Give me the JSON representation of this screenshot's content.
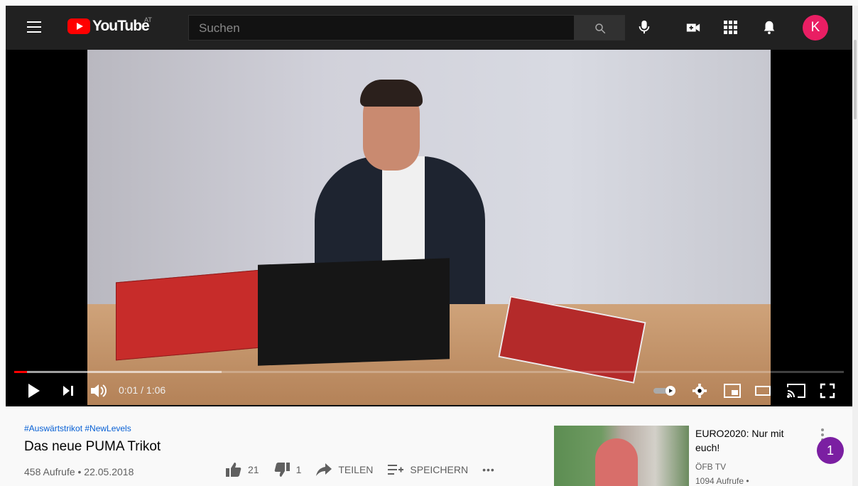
{
  "header": {
    "logo_text": "YouTube",
    "region": "AT",
    "search_placeholder": "Suchen",
    "avatar_letter": "K",
    "colors": {
      "bar": "#212121",
      "logo_red": "#ff0000",
      "avatar": "#e91e63"
    },
    "icons": [
      "menu-icon",
      "search-icon",
      "microphone-icon",
      "create-video-icon",
      "apps-icon",
      "notifications-icon"
    ]
  },
  "player": {
    "time": "0:01 / 1:06",
    "progress_played": 0.015,
    "progress_buffered": 0.25,
    "icons": [
      "play-icon",
      "next-icon",
      "volume-icon",
      "autoplay-icon",
      "settings-icon",
      "miniplayer-icon",
      "theater-icon",
      "cast-icon",
      "fullscreen-icon"
    ]
  },
  "video": {
    "tags": "#Auswärtstrikot #NewLevels",
    "title": "Das neue PUMA Trikot",
    "meta": "458 Aufrufe • 22.05.2018",
    "likes": "21",
    "dislikes": "1",
    "share": "TEILEN",
    "save": "SPEICHERN",
    "more": "•••"
  },
  "related": {
    "title": "EURO2020: Nur mit euch!",
    "channel": "ÖFB TV",
    "views": "1094 Aufrufe •",
    "badge": "1"
  }
}
